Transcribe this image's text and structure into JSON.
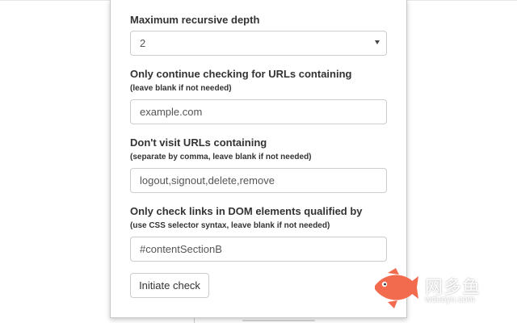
{
  "form": {
    "depth": {
      "label": "Maximum recursive depth",
      "selected": "2"
    },
    "contain": {
      "label": "Only continue checking for URLs containing",
      "hint": "(leave blank if not needed)",
      "value": "example.com"
    },
    "exclude": {
      "label": "Don't visit URLs containing",
      "hint": "(separate by comma, leave blank if not needed)",
      "value": "logout,signout,delete,remove"
    },
    "selector": {
      "label": "Only check links in DOM elements qualified by",
      "hint": "(use CSS selector syntax, leave blank if not needed)",
      "value": "#contentSectionB"
    },
    "submit_label": "Initiate check"
  },
  "watermark": {
    "brand_cn": "网多鱼",
    "domain": "wduoyu.com",
    "accent": "#f26b4f",
    "icon": "fish-logo-icon"
  }
}
